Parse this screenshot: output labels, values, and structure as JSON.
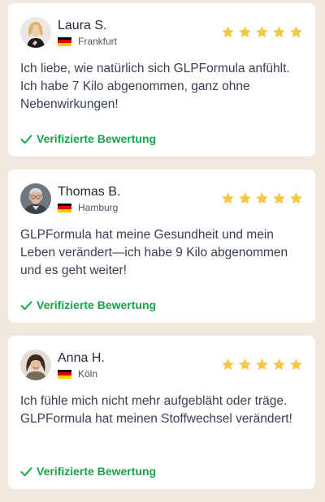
{
  "colors": {
    "background": "#f1e9df",
    "card": "#ffffff",
    "star": "#f6c744",
    "verified": "#16a34a",
    "flag": [
      "#000000",
      "#dd0000",
      "#ffce00"
    ]
  },
  "reviews": [
    {
      "name": "Laura S.",
      "city": "Frankfurt",
      "rating": 5,
      "text": "Ich liebe, wie natürlich sich GLPFormula anfühlt. Ich habe 7 Kilo abgenommen, ganz ohne Nebenwirkungen!",
      "verified_label": "Verifizierte Bewertung",
      "avatar_icon": "woman-blonde-avatar"
    },
    {
      "name": "Thomas B.",
      "city": "Hamburg",
      "rating": 5,
      "text": "GLPFormula hat meine Gesundheit und mein Leben verändert—ich habe 9 Kilo abgenommen und es geht weiter!",
      "verified_label": "Verifizierte Bewertung",
      "avatar_icon": "man-grey-hair-avatar"
    },
    {
      "name": "Anna H.",
      "city": "Köln",
      "rating": 5,
      "text": "Ich fühle mich nicht mehr aufgebläht oder träge. GLPFormula hat meinen Stoffwechsel verändert!",
      "verified_label": "Verifizierte Bewertung",
      "avatar_icon": "woman-brunette-avatar"
    }
  ]
}
